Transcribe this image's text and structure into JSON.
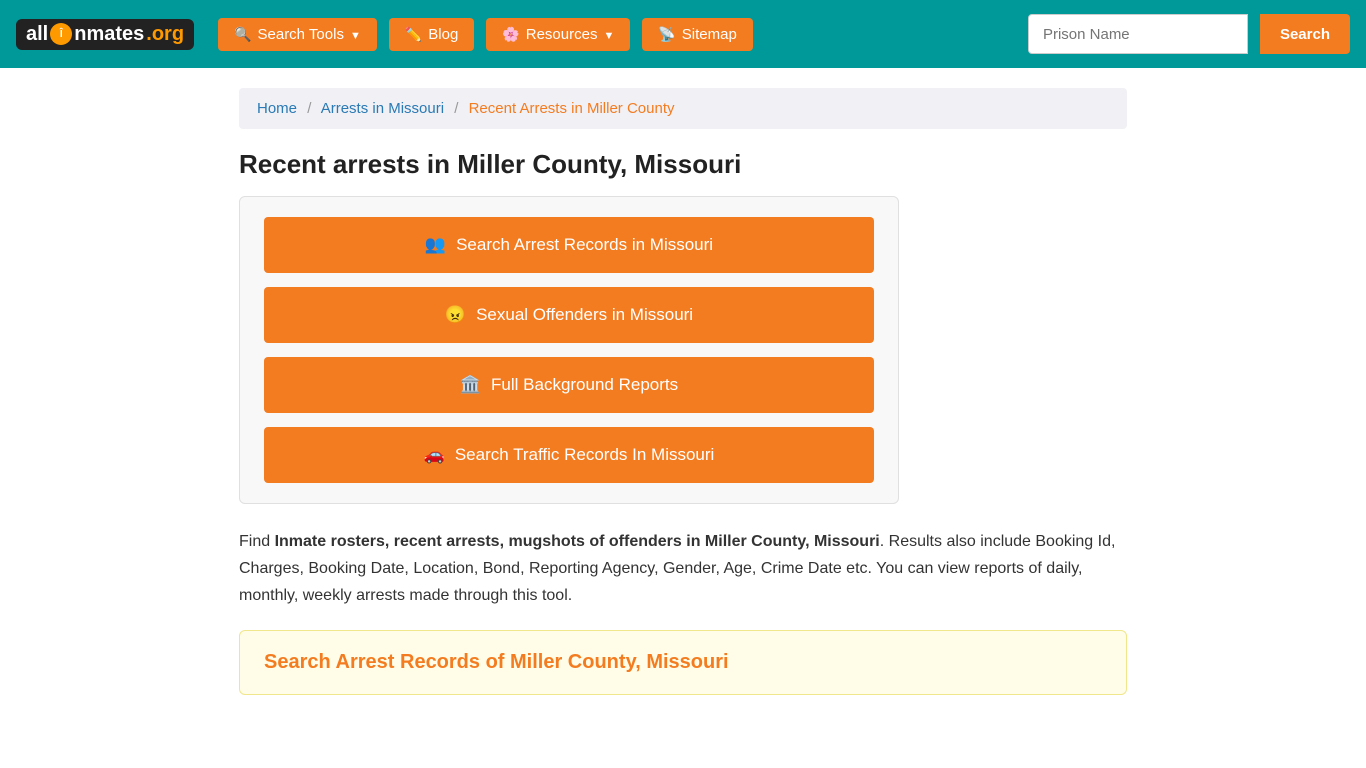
{
  "brand": {
    "name": "AllInmates.org",
    "logo_text_all": "all",
    "logo_text_inmates": "Inmates",
    "logo_text_org": ".org"
  },
  "navbar": {
    "search_tools_label": "Search Tools",
    "blog_label": "Blog",
    "resources_label": "Resources",
    "sitemap_label": "Sitemap",
    "prison_name_placeholder": "Prison Name",
    "search_label": "Search"
  },
  "breadcrumb": {
    "home": "Home",
    "arrests_in_missouri": "Arrests in Missouri",
    "current": "Recent Arrests in Miller County"
  },
  "page": {
    "title": "Recent arrests in Miller County, Missouri"
  },
  "action_buttons": {
    "btn1": "Search Arrest Records in Missouri",
    "btn2": "Sexual Offenders in Missouri",
    "btn3": "Full Background Reports",
    "btn4": "Search Traffic Records In Missouri"
  },
  "description": {
    "prefix": "Find ",
    "bold_text": "Inmate rosters, recent arrests, mugshots of offenders in Miller County, Missouri",
    "suffix": ". Results also include Booking Id, Charges, Booking Date, Location, Bond, Reporting Agency, Gender, Age, Crime Date etc. You can view reports of daily, monthly, weekly arrests made through this tool."
  },
  "search_section": {
    "title": "Search Arrest Records of Miller County, Missouri"
  }
}
